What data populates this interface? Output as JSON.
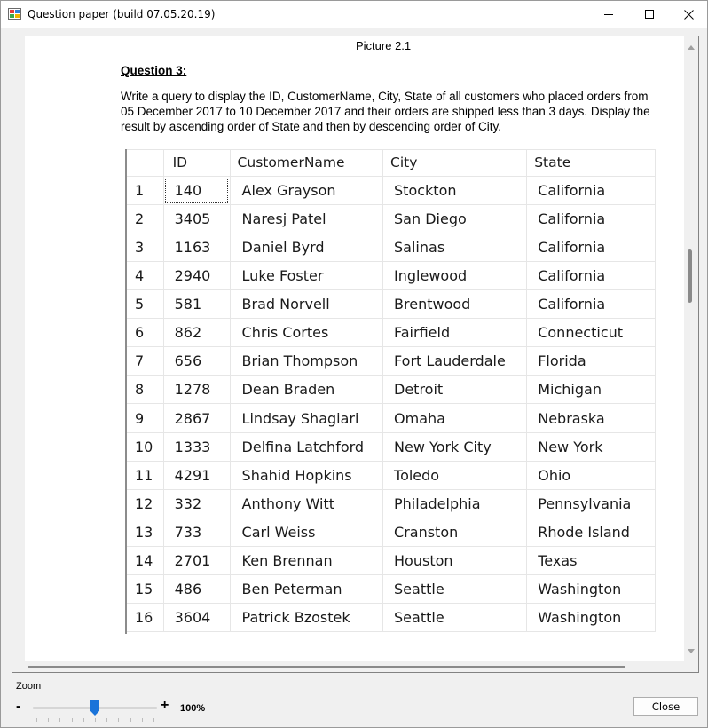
{
  "window": {
    "title": "Question paper (build 07.05.20.19)",
    "controls": {
      "minimize": "minimize",
      "maximize": "maximize",
      "close": "close"
    }
  },
  "document": {
    "picture_caption": "Picture 2.1",
    "question_heading": "Question 3:",
    "question_text": "Write a query to display the ID, CustomerName, City, State of all customers who placed orders from 05 December 2017 to 10 December 2017 and their orders are shipped less than 3 days. Display the result by ascending order of State and then by descending order of City.",
    "table": {
      "headers": [
        "",
        "ID",
        "CustomerName",
        "City",
        "State"
      ],
      "rows": [
        [
          "1",
          "140",
          "Alex Grayson",
          "Stockton",
          "California"
        ],
        [
          "2",
          "3405",
          "Naresj Patel",
          "San Diego",
          "California"
        ],
        [
          "3",
          "1163",
          "Daniel Byrd",
          "Salinas",
          "California"
        ],
        [
          "4",
          "2940",
          "Luke Foster",
          "Inglewood",
          "California"
        ],
        [
          "5",
          "581",
          "Brad Norvell",
          "Brentwood",
          "California"
        ],
        [
          "6",
          "862",
          "Chris Cortes",
          "Fairfield",
          "Connecticut"
        ],
        [
          "7",
          "656",
          "Brian Thompson",
          "Fort Lauderdale",
          "Florida"
        ],
        [
          "8",
          "1278",
          "Dean Braden",
          "Detroit",
          "Michigan"
        ],
        [
          "9",
          "2867",
          "Lindsay Shagiari",
          "Omaha",
          "Nebraska"
        ],
        [
          "10",
          "1333",
          "Delfina Latchford",
          "New York City",
          "New York"
        ],
        [
          "11",
          "4291",
          "Shahid Hopkins",
          "Toledo",
          "Ohio"
        ],
        [
          "12",
          "332",
          "Anthony Witt",
          "Philadelphia",
          "Pennsylvania"
        ],
        [
          "13",
          "733",
          "Carl Weiss",
          "Cranston",
          "Rhode Island"
        ],
        [
          "14",
          "2701",
          "Ken Brennan",
          "Houston",
          "Texas"
        ],
        [
          "15",
          "486",
          "Ben Peterman",
          "Seattle",
          "Washington"
        ],
        [
          "16",
          "3604",
          "Patrick Bzostek",
          "Seattle",
          "Washington"
        ]
      ]
    }
  },
  "zoom": {
    "label": "Zoom",
    "minus": "-",
    "plus": "+",
    "value": "100%",
    "level_fraction": 0.5
  },
  "footer": {
    "close_label": "Close"
  },
  "colors": {
    "accent": "#1a73d9"
  }
}
